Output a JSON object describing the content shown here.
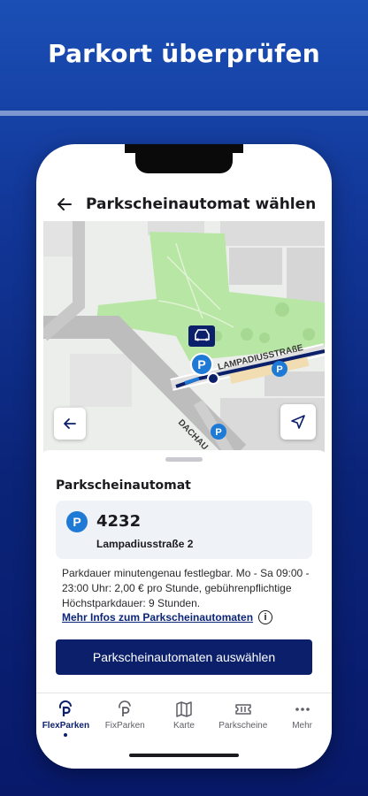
{
  "headline": "Parkort überprüfen",
  "appbar": {
    "title": "Parkscheinautomat wählen"
  },
  "map": {
    "street_label_1": "LAMPADIUSSTRAßE",
    "street_label_2": "DACHAU"
  },
  "sheet": {
    "title": "Parkscheinautomat",
    "machine": {
      "badge": "P",
      "number": "4232",
      "street": "Lampadiusstraße 2"
    },
    "info_text": "Parkdauer minutengenau festlegbar. Mo - Sa 09:00 - 23:00 Uhr: 2,00 € pro Stunde, gebührenpflichtige Höchstparkdauer: 9 Stunden.",
    "more_link": "Mehr Infos zum Parkscheinautomaten",
    "info_icon": "i",
    "primary_button": "Parkscheinautomaten auswählen"
  },
  "tabs": [
    {
      "label": "FlexParken",
      "icon": "flex-parking-icon",
      "active": true
    },
    {
      "label": "FixParken",
      "icon": "fix-parking-icon",
      "active": false
    },
    {
      "label": "Karte",
      "icon": "map-icon",
      "active": false
    },
    {
      "label": "Parkscheine",
      "icon": "ticket-icon",
      "active": false
    },
    {
      "label": "Mehr",
      "icon": "more-icon",
      "active": false
    }
  ],
  "colors": {
    "accent": "#0b1f6b",
    "park_blue": "#1f7ad6",
    "park_green": "#b8e6a4"
  }
}
